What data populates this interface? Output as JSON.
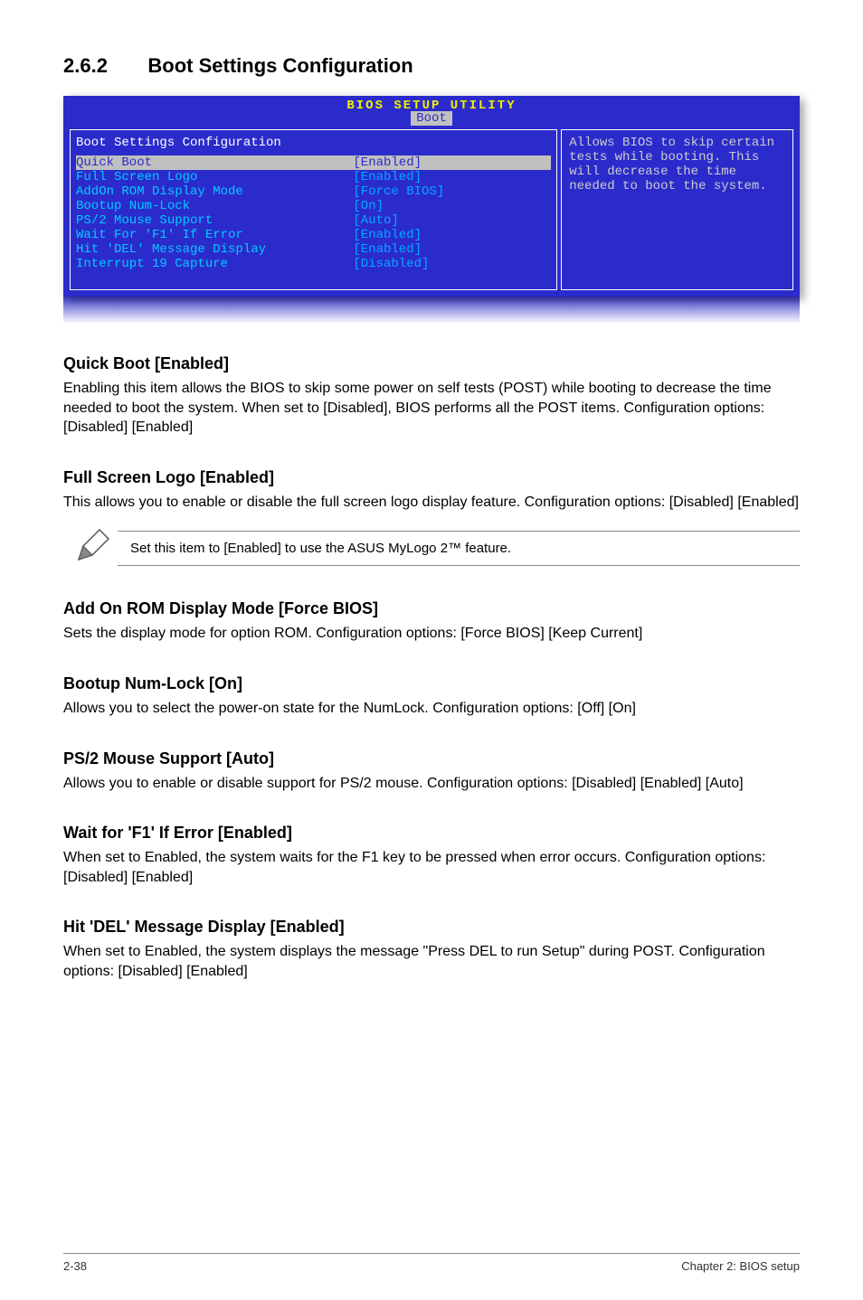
{
  "section": {
    "number": "2.6.2",
    "title": "Boot Settings Configuration"
  },
  "bios": {
    "utility_title": "BIOS SETUP UTILITY",
    "tab": "Boot",
    "header": "Boot Settings Configuration",
    "rows": [
      {
        "label": "Quick Boot",
        "value": "[Enabled]",
        "selected": true
      },
      {
        "label": "Full Screen Logo",
        "value": "[Enabled]"
      },
      {
        "label": "AddOn ROM Display Mode",
        "value": "[Force BIOS]"
      },
      {
        "label": "Bootup Num-Lock",
        "value": "[On]"
      },
      {
        "label": "PS/2 Mouse Support",
        "value": "[Auto]"
      },
      {
        "label": "Wait For 'F1' If Error",
        "value": "[Enabled]"
      },
      {
        "label": "Hit 'DEL' Message Display",
        "value": "[Enabled]"
      },
      {
        "label": "Interrupt 19 Capture",
        "value": "[Disabled]"
      }
    ],
    "help": "Allows BIOS to skip certain tests while booting. This will decrease the time needed to boot the system."
  },
  "blocks": [
    {
      "heading": "Quick Boot [Enabled]",
      "text": "Enabling this item allows the BIOS to skip some power on self tests (POST) while booting to decrease the time needed to boot the system. When set to [Disabled], BIOS performs all the POST items. Configuration options: [Disabled] [Enabled]"
    },
    {
      "heading": "Full Screen Logo [Enabled]",
      "text": "This allows you to enable or disable the full screen logo display feature. Configuration options: [Disabled] [Enabled]"
    }
  ],
  "note": "Set this item to [Enabled] to use the ASUS MyLogo 2™ feature.",
  "blocks2": [
    {
      "heading": "Add On ROM Display Mode [Force BIOS]",
      "text": "Sets the display mode for option ROM. Configuration options: [Force BIOS] [Keep Current]"
    },
    {
      "heading": "Bootup Num-Lock [On]",
      "text": "Allows you to select the power-on state for the NumLock. Configuration options: [Off] [On]"
    },
    {
      "heading": "PS/2 Mouse Support [Auto]",
      "text": "Allows you to enable or disable support for PS/2 mouse. Configuration options: [Disabled] [Enabled] [Auto]"
    },
    {
      "heading": "Wait for 'F1' If Error [Enabled]",
      "text": "When set to Enabled, the system waits for the F1 key to be pressed when error occurs. Configuration options: [Disabled] [Enabled]"
    },
    {
      "heading": "Hit 'DEL' Message Display [Enabled]",
      "text": "When set to Enabled, the system displays the message \"Press DEL to run Setup\" during POST. Configuration options: [Disabled] [Enabled]"
    }
  ],
  "footer": {
    "left": "2-38",
    "right": "Chapter 2: BIOS setup"
  }
}
